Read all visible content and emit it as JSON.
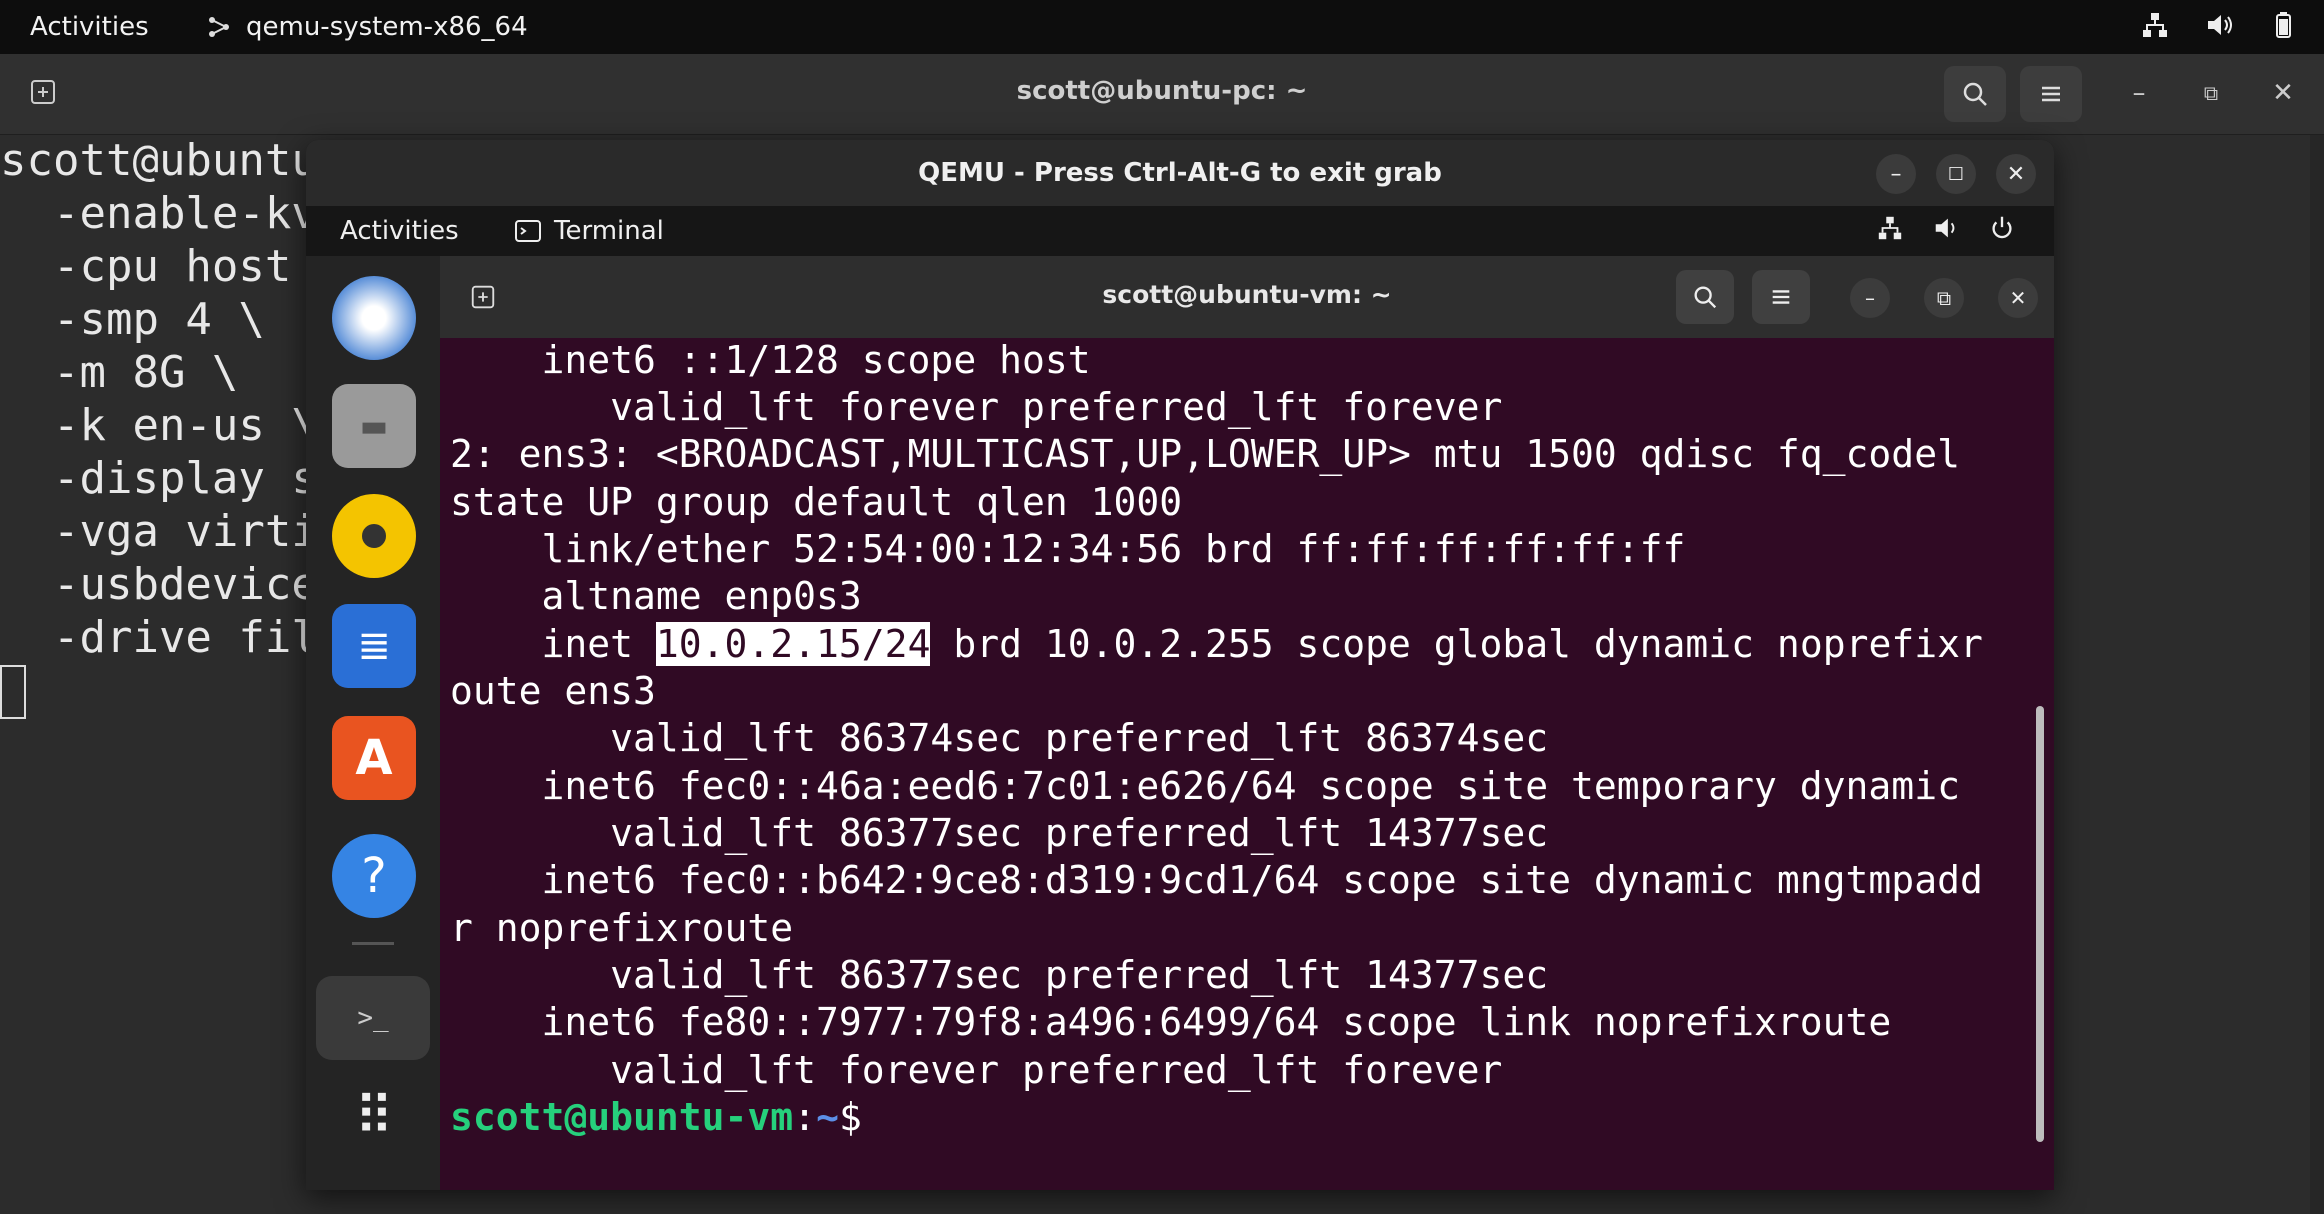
{
  "top_bar": {
    "activities": "Activities",
    "app_name": "qemu-system-x86_64"
  },
  "host_terminal": {
    "title": "scott@ubuntu-pc: ~",
    "lines": [
      "scott@ubuntu",
      "  -enable-kv",
      "  -cpu host ",
      "  -smp 4 \\",
      "  -m 8G \\",
      "  -k en-us \\",
      "  -display s",
      "  -vga virti",
      "  -usbdevice",
      "  -drive fil"
    ]
  },
  "qemu_window": {
    "title": "QEMU - Press Ctrl-Alt-G to exit grab"
  },
  "vm_top_bar": {
    "activities": "Activities",
    "app_name": "Terminal"
  },
  "vm_terminal": {
    "title": "scott@ubuntu-vm: ~",
    "lines": [
      "    inet6 ::1/128 scope host ",
      "       valid_lft forever preferred_lft forever",
      "2: ens3: <BROADCAST,MULTICAST,UP,LOWER_UP> mtu 1500 qdisc fq_codel",
      "state UP group default qlen 1000",
      "    link/ether 52:54:00:12:34:56 brd ff:ff:ff:ff:ff:ff",
      "    altname enp0s3",
      "oute ens3",
      "       valid_lft 86374sec preferred_lft 86374sec",
      "    inet6 fec0::46a:eed6:7c01:e626/64 scope site temporary dynamic",
      "       valid_lft 86377sec preferred_lft 14377sec",
      "    inet6 fec0::b642:9ce8:d319:9cd1/64 scope site dynamic mngtmpadd",
      "r noprefixroute",
      "       valid_lft 86377sec preferred_lft 14377sec",
      "    inet6 fe80::7977:79f8:a496:6499/64 scope link noprefixroute",
      "       valid_lft forever preferred_lft forever"
    ],
    "inet_line": {
      "prefix": "    inet ",
      "selected": "10.0.2.15/24",
      "suffix": " brd 10.0.2.255 scope global dynamic noprefixr"
    },
    "prompt": {
      "user": "scott@ubuntu-vm",
      "sep": ":",
      "path": "~",
      "symbol": "$"
    }
  },
  "dock": {
    "items": [
      "thunderbird-icon",
      "files-icon",
      "rhythmbox-icon",
      "writer-icon",
      "app-center-icon",
      "help-icon",
      "terminal-icon",
      "show-apps-icon"
    ]
  }
}
